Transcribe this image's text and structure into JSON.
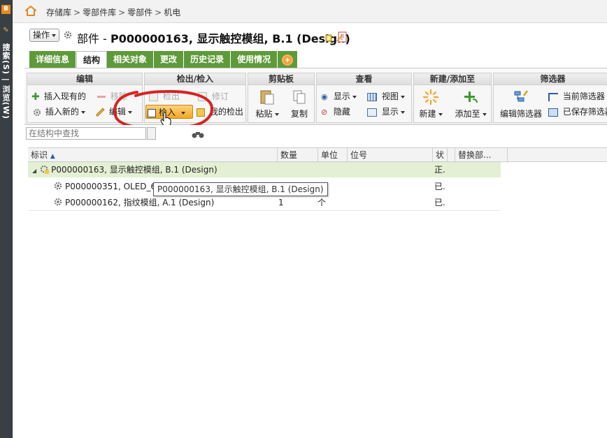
{
  "sidebar": {
    "vertical_label": "搜索(S) | 浏览(W)",
    "badge": "B"
  },
  "breadcrumb": {
    "items": [
      "存储库",
      "零部件库",
      "零部件",
      "机电"
    ],
    "separator": ">"
  },
  "header": {
    "action_label": "操作",
    "type_prefix": "部件 -",
    "title": "P000000163, 显示触控模组, B.1 (Design)"
  },
  "tabs": [
    {
      "label": "详细信息",
      "active": false
    },
    {
      "label": "结构",
      "active": true
    },
    {
      "label": "相关对象",
      "active": false
    },
    {
      "label": "更改",
      "active": false
    },
    {
      "label": "历史记录",
      "active": false
    },
    {
      "label": "使用情况",
      "active": false
    }
  ],
  "ribbon": {
    "edit": {
      "title": "编辑",
      "insert_existing": "插入现有的",
      "remove": "移除",
      "insert_new": "插入新的",
      "edit": "编辑"
    },
    "checkout": {
      "title": "检出/检入",
      "checkout": "检出",
      "revise": "修订",
      "checkin": "检入",
      "my_checkouts": "我的检出"
    },
    "clipboard": {
      "title": "剪贴板",
      "paste": "粘贴",
      "copy": "复制"
    },
    "view": {
      "title": "查看",
      "show": "显示",
      "hide": "隐藏",
      "views": "视图",
      "show2": "显示"
    },
    "new_add": {
      "title": "新建/添加至",
      "new": "新建",
      "add_to": "添加至"
    },
    "filter": {
      "title": "筛选器",
      "edit_filter": "编辑筛选器",
      "current_filter": "当前筛选器",
      "saved_filter": "已保存筛选器"
    }
  },
  "search": {
    "placeholder": "在结构中查找"
  },
  "table": {
    "columns": [
      "标识",
      "数量",
      "单位",
      "位号",
      "状",
      "替换部..."
    ],
    "rows": [
      {
        "id": "P000000163, 显示触控模组, B.1 (Design)",
        "qty": "",
        "unit": "",
        "ref": "",
        "state": "正.",
        "level": 0
      },
      {
        "id": "P000000351, OLED_6",
        "qty": "",
        "unit": "个",
        "ref": "",
        "state": "已.",
        "level": 1
      },
      {
        "id": "P000000162, 指纹模组, A.1 (Design)",
        "qty": "1",
        "unit": "个",
        "ref": "",
        "state": "已.",
        "level": 1
      }
    ]
  },
  "tooltip": {
    "text": "P000000163, 显示触控模组, B.1 (Design)"
  },
  "colors": {
    "tab_green": "#5e9a3a",
    "selected_row": "#e3f0d3",
    "annotation_red": "#d8231f",
    "checkin_highlight": "#f5a623"
  }
}
